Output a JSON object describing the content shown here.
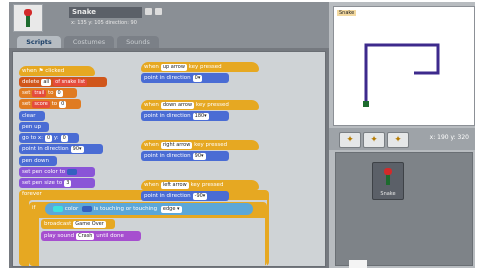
{
  "sprite": {
    "name": "Snake",
    "info": "x: 135 y: 105 direction: 90"
  },
  "tabs": [
    {
      "label": "Scripts"
    },
    {
      "label": "Costumes"
    },
    {
      "label": "Sounds"
    }
  ],
  "scripts_left": {
    "hat": "when ⚑ clicked",
    "delete": "delete",
    "delete_arg1": "all",
    "delete_arg2": "of snake list",
    "set1": "set",
    "set1_var": "trail",
    "set1_to": "to",
    "set1_val": "0",
    "set2": "set",
    "set2_var": "score",
    "set2_to": "to",
    "set2_val": "0",
    "clear": "clear",
    "pen_up": "pen up",
    "go_to": "go to x:",
    "go_to_x": "0",
    "go_to_y_label": "y:",
    "go_to_y": "0",
    "point": "point in direction",
    "point_val": "90▾",
    "pen_down": "pen down",
    "set_pen_color": "set pen color to",
    "set_pen_size": "set pen size to",
    "set_pen_size_val": "3",
    "forever": "forever",
    "if_label": "if",
    "touching_color": "color",
    "touching_text": "is touching",
    "or_text": "or",
    "touching_edge": "touching",
    "touching_edge_val": "edge ▾",
    "broadcast": "broadcast",
    "broadcast_val": "Game Over",
    "play_sound": "play sound",
    "play_sound_val": "Crash",
    "until_done": "until done"
  },
  "scripts_right": [
    {
      "hat": "when",
      "key": "up arrow",
      "suffix": "key pressed",
      "action": "point in direction",
      "dir": "0▾"
    },
    {
      "hat": "when",
      "key": "down arrow",
      "suffix": "key pressed",
      "action": "point in direction",
      "dir": "180▾"
    },
    {
      "hat": "when",
      "key": "right arrow",
      "suffix": "key pressed",
      "action": "point in direction",
      "dir": "90▾"
    },
    {
      "hat": "when",
      "key": "left arrow",
      "suffix": "key pressed",
      "action": "point in direction",
      "dir": "-90▾"
    }
  ],
  "stage": {
    "tag": "Snake"
  },
  "stage_controls": {
    "coords": "x: 190  y: 320"
  },
  "sprite_tile": {
    "label": "Snake"
  },
  "colors": {
    "motion": "#4a6cd4",
    "control": "#e6a822",
    "pen": "#8a55d7",
    "snake_trail": "#3d2a8c"
  }
}
